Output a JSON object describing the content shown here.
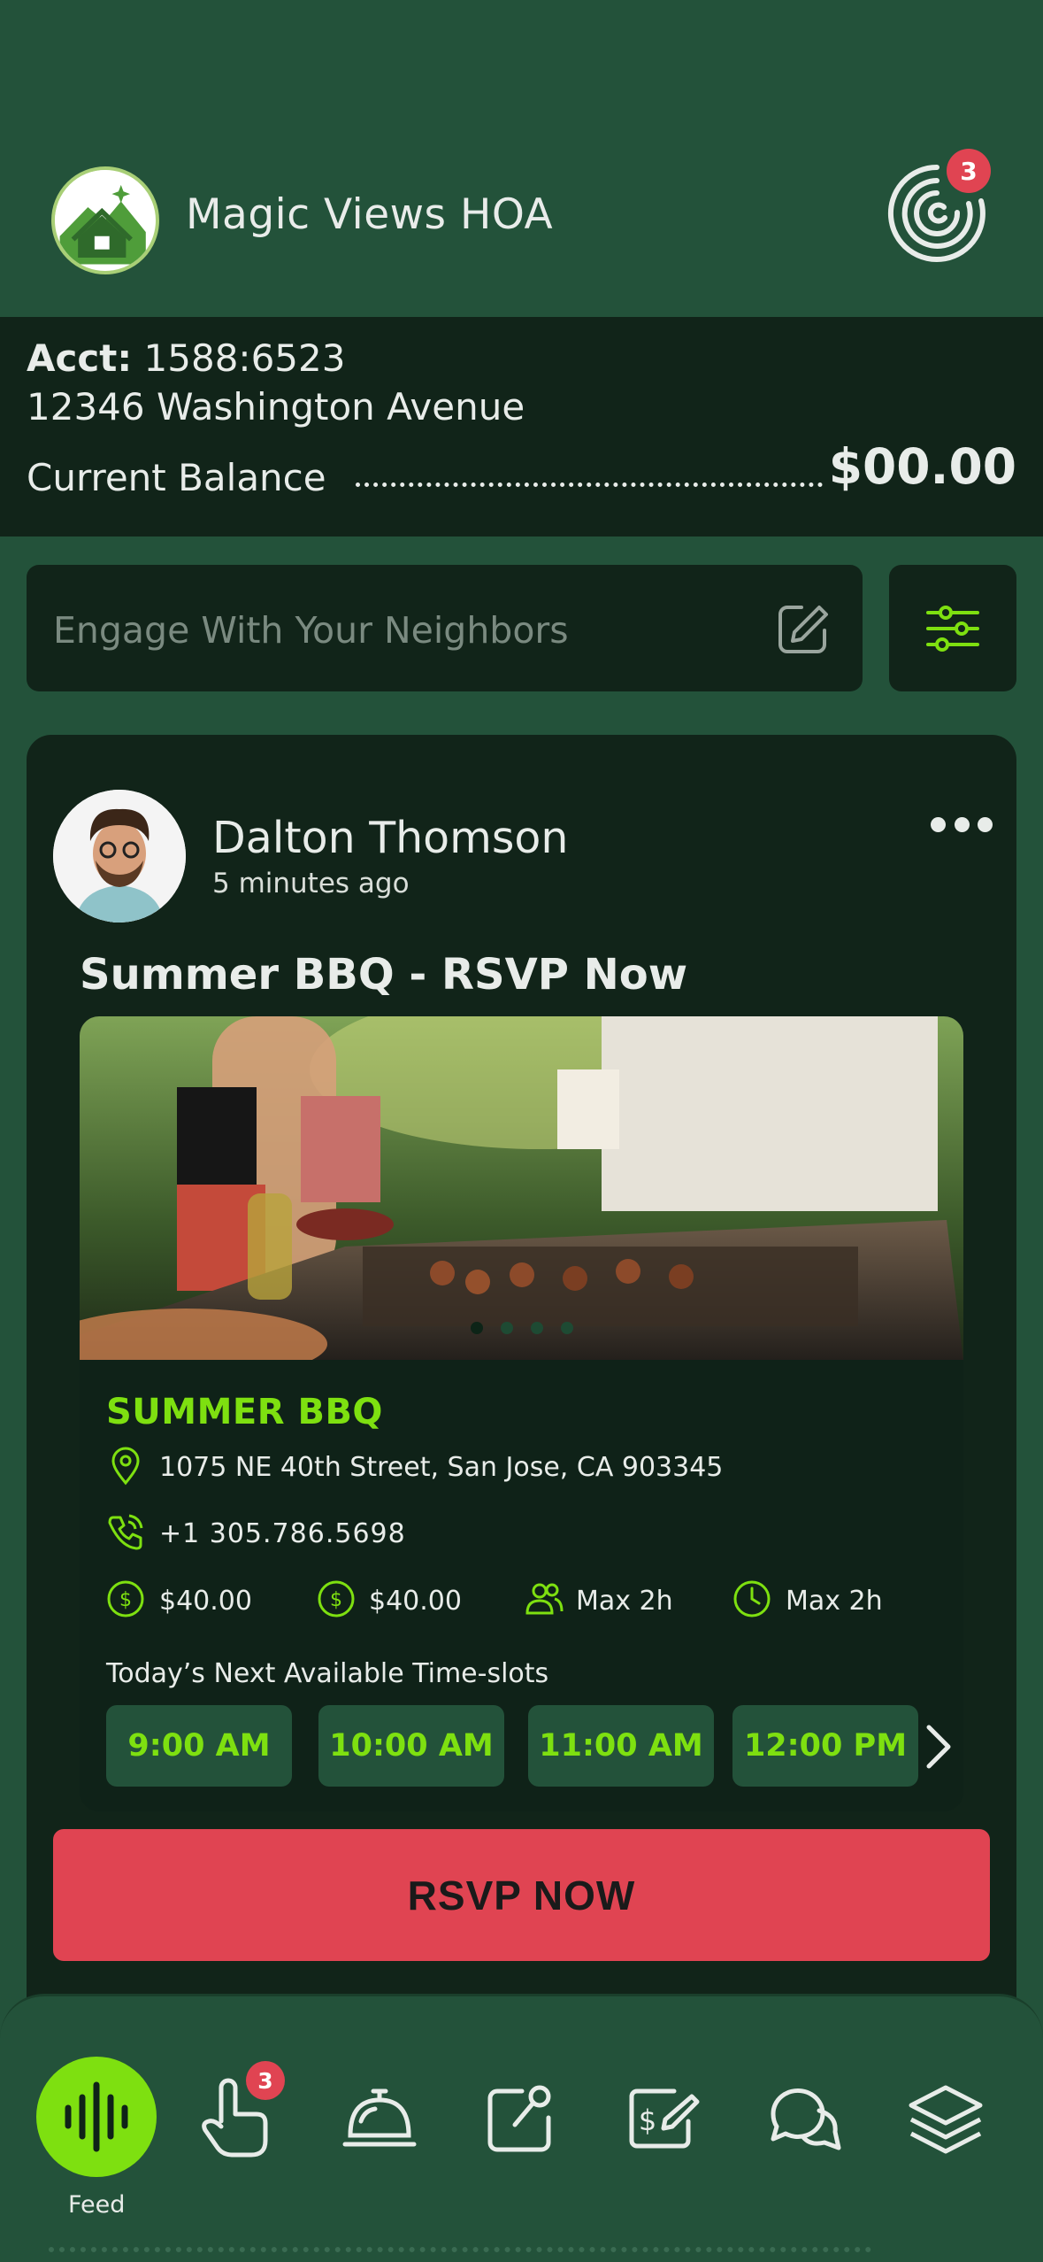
{
  "header": {
    "title": "Magic Views HOA",
    "notification_count": "3"
  },
  "account": {
    "acct_label": "Acct:",
    "acct_number": "1588:6523",
    "address": "12346 Washington Avenue",
    "balance_label": "Current Balance",
    "balance_value": "$00.00"
  },
  "search": {
    "placeholder": "Engage With Your Neighbors"
  },
  "post": {
    "author": "Dalton Thomson",
    "time_ago": "5 minutes ago",
    "title": "Summer BBQ - RSVP Now",
    "event": {
      "name": "SUMMER BBQ",
      "address": "1075 NE 40th Street, San Jose, CA 903345",
      "phone": "+1 305.786.5698",
      "price1": "$40.00",
      "price2": "$40.00",
      "max_people": "Max 2h",
      "max_time": "Max 2h",
      "slots_label": "Today’s Next Available Time-slots",
      "slots": [
        "9:00 AM",
        "10:00 AM",
        "11:00 AM",
        "12:00 PM"
      ]
    },
    "rsvp_label": "RSVP NOW"
  },
  "nav": {
    "feed_label": "Feed",
    "badge_count": "3",
    "icons": [
      "feed-icon",
      "tap-icon",
      "concierge-bell-icon",
      "maintenance-request-icon",
      "payment-icon",
      "chat-icon",
      "layers-icon"
    ]
  },
  "colors": {
    "accent": "#7ee010",
    "bg": "#23523a",
    "panel": "#112419",
    "danger": "#e04452"
  }
}
